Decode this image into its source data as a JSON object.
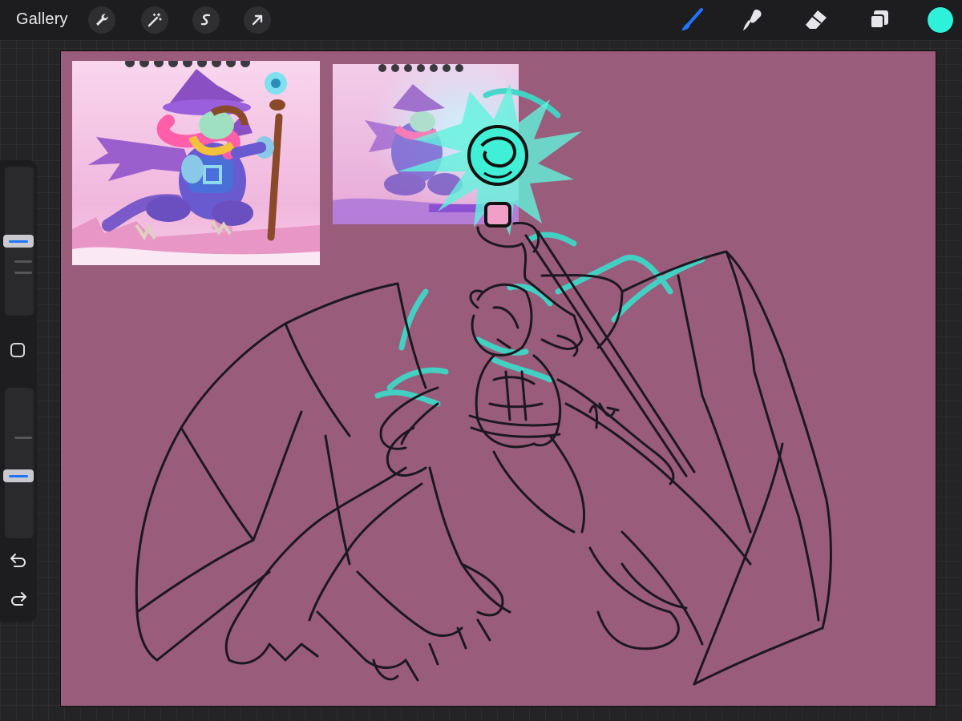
{
  "toolbar": {
    "gallery_label": "Gallery",
    "left_tools": [
      "wrench-icon",
      "magic-wand-icon",
      "selection-icon",
      "transform-arrow-icon"
    ],
    "right_tools": [
      "brush-icon",
      "smudge-icon",
      "eraser-icon",
      "layers-icon"
    ],
    "active_tool": "brush-icon",
    "current_color": "#2ff0d8",
    "accent_color": "#1f74ff"
  },
  "sidebar": {
    "brush_size_level": 0.55,
    "opacity_level": 0.58,
    "icons": [
      "modify-square-icon",
      "undo-icon",
      "redo-icon"
    ]
  },
  "canvas": {
    "background_color": "#9a5c7b",
    "line_color": "#1c1820",
    "highlight_color": "#3fd6c6"
  }
}
